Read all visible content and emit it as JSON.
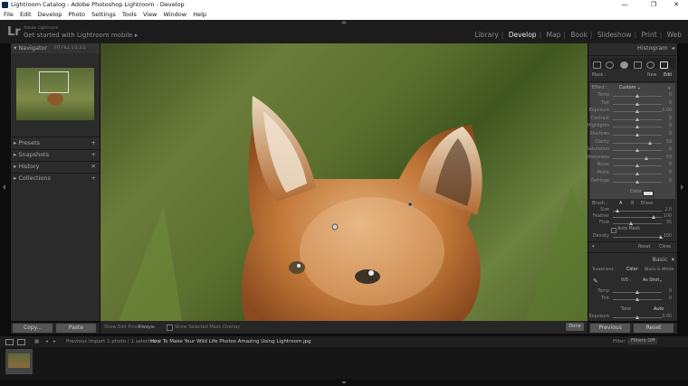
{
  "window": {
    "title": "Lightroom Catalog - Adobe Photoshop Lightroom - Develop",
    "minimize": "—",
    "maximize": "❐",
    "close": "✕"
  },
  "menubar": [
    "File",
    "Edit",
    "Develop",
    "Photo",
    "Settings",
    "Tools",
    "View",
    "Window",
    "Help"
  ],
  "identity": {
    "logo": "Lr",
    "small": "Adobe Lightroom",
    "tagline": "Get started with Lightroom mobile",
    "tag_arrow": "▸"
  },
  "modules": {
    "items": [
      "Library",
      "Develop",
      "Map",
      "Book",
      "Slideshow",
      "Print",
      "Web"
    ],
    "active": "Develop"
  },
  "left_panel": {
    "navigator": {
      "title": "Navigator",
      "zoom_options": [
        "FIT",
        "FILL",
        "1:1",
        "3:1"
      ]
    },
    "sections": [
      "Presets",
      "Snapshots",
      "History",
      "Collections"
    ]
  },
  "left_buttons": {
    "copy": "Copy...",
    "paste": "Paste"
  },
  "toolbar": {
    "show_edit_pins_label": "Show Edit Pins :",
    "show_edit_pins_value": "Always",
    "show_mask_label": "Show Selected Mask Overlay",
    "done": "Done"
  },
  "right_buttons": {
    "previous": "Previous",
    "reset": "Reset"
  },
  "right_panel": {
    "histogram_title": "Histogram",
    "mask_label": "Mask :",
    "mask_new": "New",
    "mask_edit": "Edit",
    "effect_label": "Effect :",
    "effect_value": "Custom",
    "sliders": [
      {
        "label": "Temp",
        "val": "0"
      },
      {
        "label": "Tint",
        "val": "0"
      },
      {
        "label": "Exposure",
        "val": "0.00"
      },
      {
        "label": "Contrast",
        "val": "0"
      },
      {
        "label": "Highlights",
        "val": "0"
      },
      {
        "label": "Shadows",
        "val": "0"
      },
      {
        "label": "Clarity",
        "val": "59"
      },
      {
        "label": "Saturation",
        "val": "0"
      },
      {
        "label": "Sharpness",
        "val": "50"
      },
      {
        "label": "Noise",
        "val": "0"
      },
      {
        "label": "Moiré",
        "val": "0"
      },
      {
        "label": "Defringe",
        "val": "0"
      }
    ],
    "color_label": "Color",
    "brush": {
      "label": "Brush :",
      "a": "A",
      "b": "B",
      "erase": "Erase"
    },
    "brush_sliders": [
      {
        "label": "Size",
        "val": "2.0"
      },
      {
        "label": "Feather",
        "val": "100"
      },
      {
        "label": "Flow",
        "val": "35"
      }
    ],
    "auto_mask": "Auto Mask",
    "density": {
      "label": "Density",
      "val": "100"
    },
    "reset": "Reset",
    "close": "Close",
    "basic_title": "Basic",
    "treatment_label": "Treatment :",
    "treatment_color": "Color",
    "treatment_bw": "Black & White",
    "wb_label": "WB :",
    "wb_value": "As Shot",
    "basic_sliders": [
      {
        "label": "Temp",
        "val": "0"
      },
      {
        "label": "Tint",
        "val": "0"
      }
    ],
    "tone_label": "Tone",
    "tone_auto": "Auto",
    "exposure": {
      "label": "Exposure",
      "val": "0.00"
    }
  },
  "filmstrip_bar": {
    "previous_import": "Previous Import",
    "count": "1 photo / 1 selected /",
    "filename": "How To Make Your Wild Life Photos Amazing Using Lightroom.jpg",
    "filter_label": "Filter :",
    "filter_value": "Filters Off"
  }
}
